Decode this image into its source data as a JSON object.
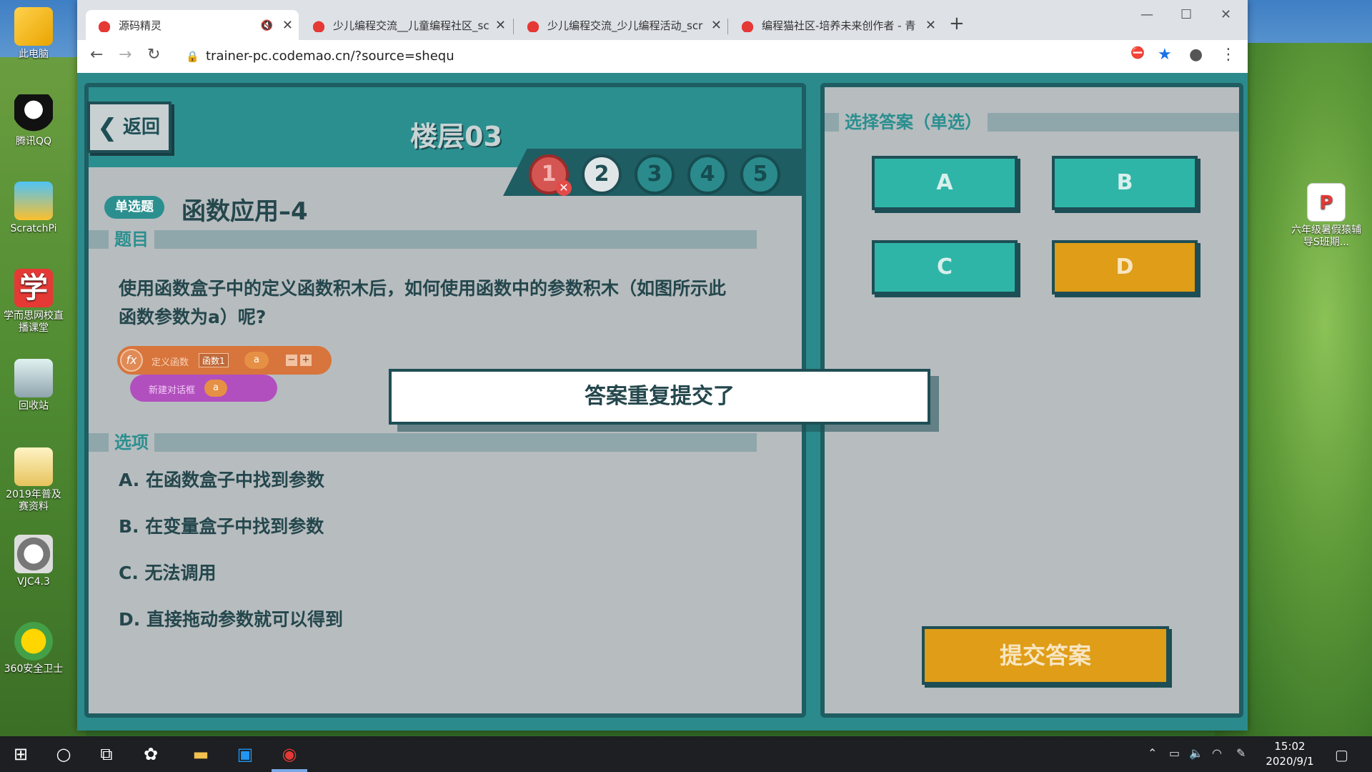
{
  "desktop": {
    "icons": [
      {
        "label": "此电脑",
        "icon": "computer-icon"
      },
      {
        "label": "腾讯QQ",
        "icon": "qq-icon"
      },
      {
        "label": "ScratchPi",
        "icon": "scratchpi-icon"
      },
      {
        "label": "学而思网校直播课堂",
        "icon": "xueersi-icon"
      },
      {
        "label": "回收站",
        "icon": "recycle-bin-icon"
      },
      {
        "label": "2019年普及赛资料",
        "icon": "folder-icon"
      },
      {
        "label": "VJC4.3",
        "icon": "vjc-icon"
      },
      {
        "label": "360安全卫士",
        "icon": "360-icon"
      },
      {
        "label": "六年级暑假猿辅导S班期...",
        "icon": "pdf-icon"
      }
    ]
  },
  "browser": {
    "tabs": [
      {
        "title": "源码精灵",
        "active": true,
        "muted": true
      },
      {
        "title": "少儿编程交流__儿童编程社区_sc",
        "active": false
      },
      {
        "title": "少儿编程交流_少儿编程活动_scr",
        "active": false
      },
      {
        "title": "编程猫社区-培养未来创作者 - 青",
        "active": false
      }
    ],
    "new_tab": "+",
    "url": "trainer-pc.codemao.cn/?source=shequ"
  },
  "page": {
    "back_label": "返回",
    "floor_title": "楼层03",
    "steps": [
      "1",
      "2",
      "3",
      "4",
      "5"
    ],
    "step_states": [
      "wrong",
      "current",
      "todo",
      "todo",
      "todo"
    ],
    "question_type": "单选题",
    "question_title": "函数应用–4",
    "section_question": "题目",
    "question_text": "使用函数盒子中的定义函数积木后，如何使用函数中的参数积木（如图所示此函数参数为a）呢?",
    "block_define": {
      "label": "定义函数",
      "name": "函数1",
      "param": "a"
    },
    "block_new_dialog": {
      "label": "新建对话框",
      "param": "a"
    },
    "section_options": "选项",
    "options": [
      "A. 在函数盒子中找到参数",
      "B. 在变量盒子中找到参数",
      "C. 无法调用",
      "D. 直接拖动参数就可以得到"
    ],
    "answer_heading": "选择答案（单选）",
    "answers": [
      "A",
      "B",
      "C",
      "D"
    ],
    "selected_answer": "D",
    "submit_label": "提交答案",
    "toast": "答案重复提交了"
  },
  "taskbar": {
    "time": "15:02",
    "date": "2020/9/1"
  },
  "colors": {
    "teal_dark": "#1e5d62",
    "teal": "#2b8f8f",
    "answer_teal": "#2eb5a7",
    "gold": "#df9d18",
    "error_red": "#d45552"
  }
}
